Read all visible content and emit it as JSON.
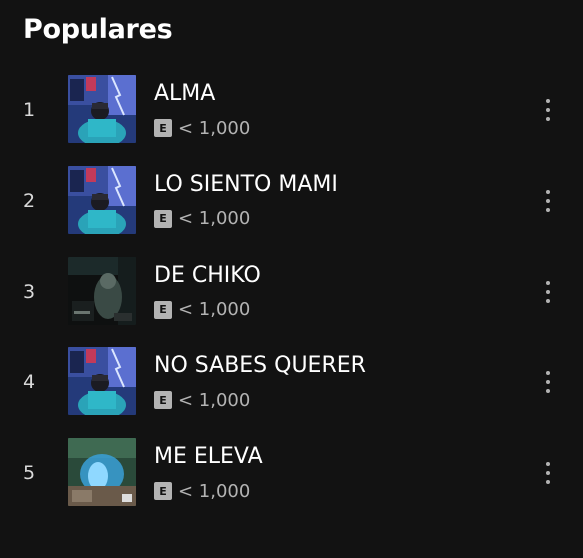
{
  "section": {
    "title": "Populares"
  },
  "tracks": [
    {
      "index": "1",
      "title": "ALMA",
      "explicit": "E",
      "plays": "< 1,000",
      "cover": "cover-blue-figure"
    },
    {
      "index": "2",
      "title": "LO SIENTO MAMI",
      "explicit": "E",
      "plays": "< 1,000",
      "cover": "cover-blue-figure"
    },
    {
      "index": "3",
      "title": "DE CHIKO",
      "explicit": "E",
      "plays": "< 1,000",
      "cover": "cover-dark-figure"
    },
    {
      "index": "4",
      "title": "NO SABES QUERER",
      "explicit": "E",
      "plays": "< 1,000",
      "cover": "cover-blue-figure"
    },
    {
      "index": "5",
      "title": "ME ELEVA",
      "explicit": "E",
      "plays": "< 1,000",
      "cover": "cover-teal-glow"
    }
  ],
  "icons": {
    "more": "more-vertical-icon",
    "explicit": "explicit-badge-icon"
  },
  "colors": {
    "background": "#121212",
    "text": "#ffffff",
    "subtext": "#b3b3b3"
  }
}
